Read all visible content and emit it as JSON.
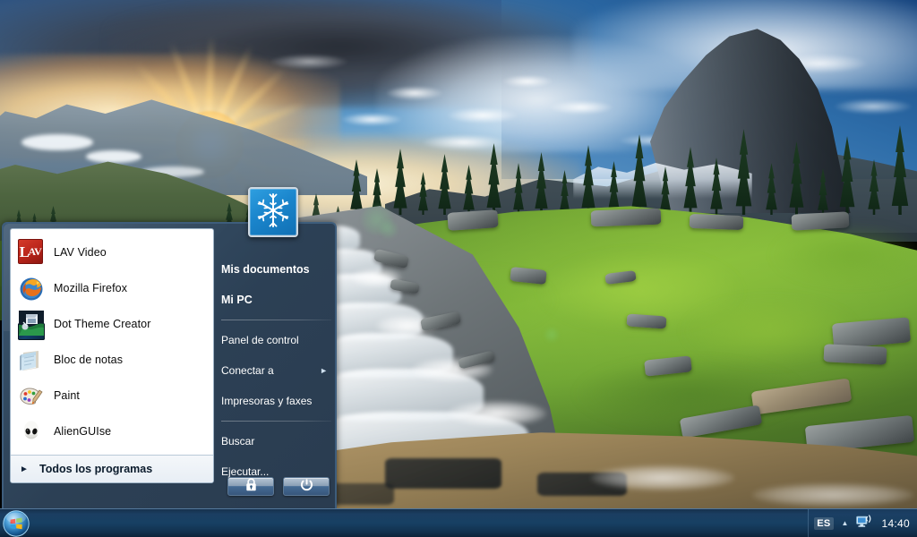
{
  "desktop": {
    "wallpaper_name": "mountain-waterfall-sunset-wallpaper",
    "colors": {
      "taskbar_top": "#1b3e62",
      "taskbar_bottom": "#0d2339",
      "menu_right_panel": "#2c4055",
      "menu_border": "#3e5d7c",
      "menu_left_panel": "#ffffff",
      "accent_blue": "#1a85cc"
    }
  },
  "start_menu": {
    "user_logo_icon": "snowflake-icon",
    "programs": [
      {
        "label": "LAV Video",
        "icon": "lav-video-icon"
      },
      {
        "label": "Mozilla Firefox",
        "icon": "firefox-icon"
      },
      {
        "label": "Dot Theme Creator",
        "icon": "dot-theme-creator-icon"
      },
      {
        "label": "Bloc de notas",
        "icon": "notepad-icon"
      },
      {
        "label": "Paint",
        "icon": "paint-icon"
      },
      {
        "label": "AlienGUIse",
        "icon": "alienguise-icon"
      }
    ],
    "all_programs": {
      "label": "Todos los programas",
      "arrow_icon": "chevron-right-icon"
    },
    "places_group_1": [
      {
        "label": "Mis documentos",
        "bold": true
      },
      {
        "label": "Mi PC",
        "bold": true
      }
    ],
    "places_group_2": [
      {
        "label": "Panel de control",
        "submenu": false
      },
      {
        "label": "Conectar a",
        "submenu": true,
        "arrow_icon": "chevron-right-icon"
      },
      {
        "label": "Impresoras y faxes",
        "submenu": false
      }
    ],
    "places_group_3": [
      {
        "label": "Buscar",
        "submenu": false
      },
      {
        "label": "Ejecutar...",
        "submenu": false
      }
    ],
    "actions": [
      {
        "name": "lock",
        "icon": "lock-icon",
        "label": ""
      },
      {
        "name": "shutdown",
        "icon": "power-icon",
        "label": ""
      }
    ]
  },
  "taskbar": {
    "start_button": {
      "icon": "windows-orb-icon",
      "label": ""
    },
    "tray": {
      "language": "ES",
      "chevron_icon": "chevron-up-icon",
      "network_icon": "network-wireless-icon",
      "clock": "14:40"
    }
  }
}
